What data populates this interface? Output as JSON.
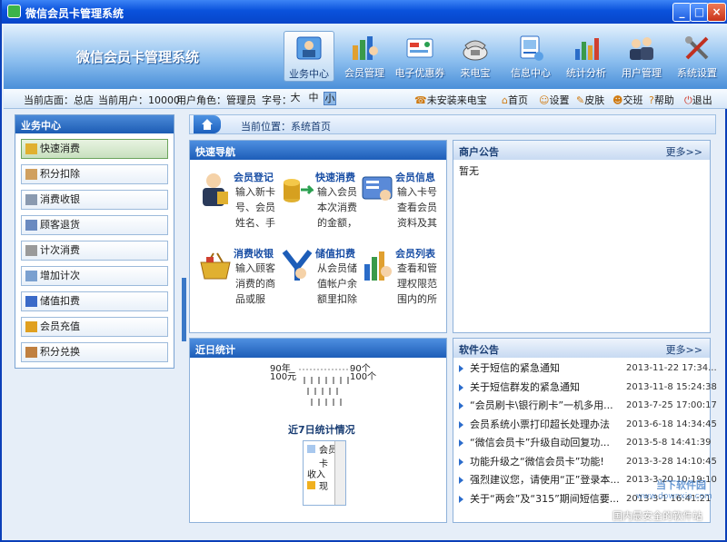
{
  "window": {
    "title": "微信会员卡管理系统",
    "buttons": [
      "_",
      "□",
      "×"
    ]
  },
  "header": {
    "app_title": "微信会员卡管理系统",
    "nav": [
      {
        "label": "业务中心",
        "icon": "business-center-icon",
        "active": true
      },
      {
        "label": "会员管理",
        "icon": "member-icon"
      },
      {
        "label": "电子优惠券",
        "icon": "coupon-icon"
      },
      {
        "label": "来电宝",
        "icon": "phone-icon"
      },
      {
        "label": "信息中心",
        "icon": "info-icon"
      },
      {
        "label": "统计分析",
        "icon": "stats-icon"
      },
      {
        "label": "用户管理",
        "icon": "users-icon"
      },
      {
        "label": "系统设置",
        "icon": "settings-icon"
      }
    ]
  },
  "infobar": {
    "store": "当前店面：总店",
    "user": "当前用户：10000",
    "role": "用户角色：管理员",
    "font_label": "字号：",
    "font_sizes": [
      "大",
      "中",
      "小"
    ],
    "caller": "未安装来电宝",
    "links": [
      "首页",
      "设置",
      "皮肤",
      "交班",
      "帮助",
      "退出"
    ]
  },
  "sidebar": {
    "title": "业务中心",
    "items": [
      "快速消费",
      "积分扣除",
      "消费收银",
      "顾客退货",
      "计次消费",
      "增加计次",
      "储值扣费",
      "会员充值",
      "积分兑换"
    ]
  },
  "breadcrumb": "当前位置：系统首页",
  "quick_nav": {
    "title": "快速导航",
    "items": [
      {
        "title": "会员登记",
        "desc": "输入新卡号、会员姓名、手"
      },
      {
        "title": "快速消费",
        "desc": "输入会员本次消费的金额，"
      },
      {
        "title": "会员信息",
        "desc": "输入卡号查看会员资料及其"
      },
      {
        "title": "消费收银",
        "desc": "输入顾客消费的商品或服"
      },
      {
        "title": "储值扣费",
        "desc": "从会员储值帐户余额里扣除"
      },
      {
        "title": "会员列表",
        "desc": "查看和管理权限范围内的所"
      }
    ]
  },
  "merchant_notice": {
    "title": "商户公告",
    "more": "更多>>",
    "content": "暂无"
  },
  "recent_stats": {
    "title": "近日统计",
    "left_top": "90年",
    "left_bottom": "100元",
    "right_top": "90个",
    "right_bottom": "100个",
    "chart_title": "近7日统计情况",
    "legend": [
      "会员卡",
      "收入",
      "现"
    ]
  },
  "software_notice": {
    "title": "软件公告",
    "more": "更多>>",
    "items": [
      {
        "title": "关于短信的紧急通知",
        "date": "2013-11-22 17:34..."
      },
      {
        "title": "关于短信群发的紧急通知",
        "date": "2013-11-8 15:24:38"
      },
      {
        "title": "“会员刷卡\\银行刷卡”一机多用...",
        "date": "2013-7-25 17:00:17"
      },
      {
        "title": "会员系统小票打印超长处理办法",
        "date": "2013-6-18 14:34:45"
      },
      {
        "title": "“微信会员卡”升级自动回复功...",
        "date": "2013-5-8 14:41:39"
      },
      {
        "title": "功能升级之“微信会员卡”功能!",
        "date": "2013-3-28 14:10:45"
      },
      {
        "title": "强烈建议您，请使用“正”登录本...",
        "date": "2013-3-20 10:19:10"
      },
      {
        "title": "关于“两会”及“315”期间短信要...",
        "date": "2013-3-1 16:41:21"
      }
    ]
  },
  "watermark": {
    "line1": "当下软件园",
    "line2": "www.downxia.com",
    "line3": "国内最安全的软件站"
  }
}
